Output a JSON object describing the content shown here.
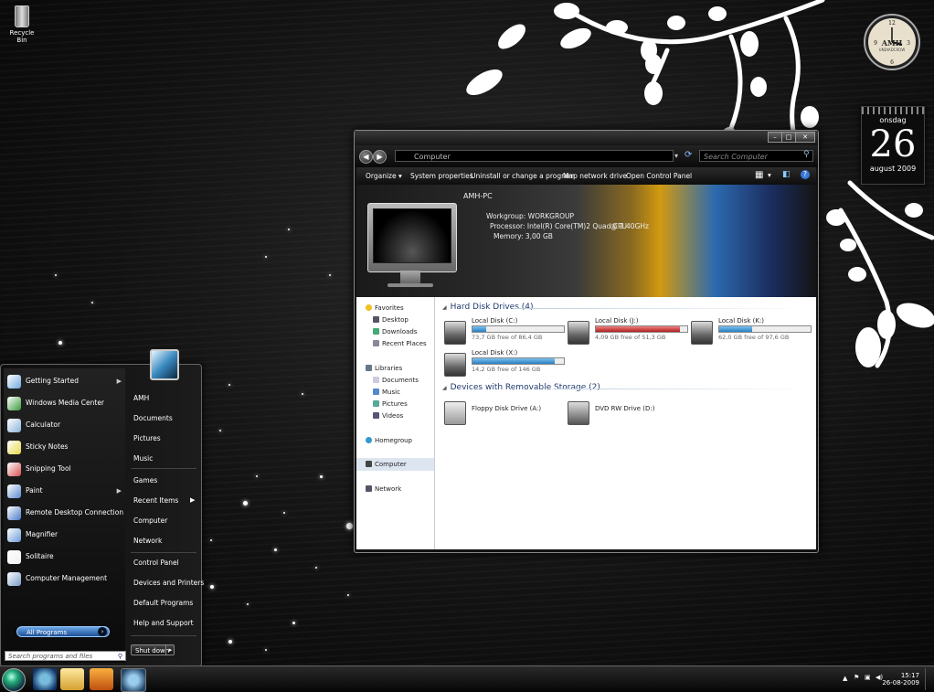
{
  "desktop": {
    "recycle_bin_label": "Recycle Bin"
  },
  "gadgets": {
    "clock_brand": "AMH",
    "clock_sub": "UNDIADCROW",
    "calendar_day_name": "onsdag",
    "calendar_day": "26",
    "calendar_month_year": "august 2009"
  },
  "explorer": {
    "address": "Computer",
    "search_placeholder": "Search Computer",
    "commands": [
      "Organize ▾",
      "System properties",
      "Uninstall or change a program",
      "Map network drive",
      "Open Control Panel"
    ],
    "pc_name": "AMH-PC",
    "workgroup": "Workgroup: WORKGROUP",
    "processor": "Processor: Intel(R) Core(TM)2 Quad CPU",
    "cpu_speed": "@ 2.40GHz",
    "memory": "Memory: 3,00 GB",
    "nav": {
      "favorites": "Favorites",
      "desktop": "Desktop",
      "downloads": "Downloads",
      "recent_places": "Recent Places",
      "libraries": "Libraries",
      "documents": "Documents",
      "music": "Music",
      "pictures": "Pictures",
      "videos": "Videos",
      "homegroup": "Homegroup",
      "computer": "Computer",
      "network": "Network"
    },
    "hard_disk_header": "Hard Disk Drives (4)",
    "removable_header": "Devices with Removable Storage (2)",
    "drives": [
      {
        "name": "Local Disk (C:)",
        "free": "73,7 GB free of 86,4 GB",
        "used_fraction": 0.15,
        "warn": false
      },
      {
        "name": "Local Disk (J:)",
        "free": "4,09 GB free of 51,3 GB",
        "used_fraction": 0.92,
        "warn": true
      },
      {
        "name": "Local Disk (K:)",
        "free": "62,0 GB free of 97,6 GB",
        "used_fraction": 0.36,
        "warn": false
      },
      {
        "name": "Local Disk (X:)",
        "free": "14,2 GB free of 146 GB",
        "used_fraction": 0.9,
        "warn": false
      }
    ],
    "removable": [
      {
        "name": "Floppy Disk Drive (A:)"
      },
      {
        "name": "DVD RW Drive (D:)"
      }
    ]
  },
  "start_menu": {
    "programs": [
      {
        "label": "Getting Started",
        "arrow": true,
        "icon_color": "#6fa8dc"
      },
      {
        "label": "Windows Media Center",
        "arrow": false,
        "icon_color": "#3a9a3a"
      },
      {
        "label": "Calculator",
        "arrow": false,
        "icon_color": "#8ab4d8"
      },
      {
        "label": "Sticky Notes",
        "arrow": false,
        "icon_color": "#e6d84a"
      },
      {
        "label": "Snipping Tool",
        "arrow": false,
        "icon_color": "#d85050"
      },
      {
        "label": "Paint",
        "arrow": true,
        "icon_color": "#5a8ad0"
      },
      {
        "label": "Remote Desktop Connection",
        "arrow": false,
        "icon_color": "#4a78c8"
      },
      {
        "label": "Magnifier",
        "arrow": false,
        "icon_color": "#6a9ad8"
      },
      {
        "label": "Solitaire",
        "arrow": false,
        "icon_color": "#f0f0f0"
      },
      {
        "label": "Computer Management",
        "arrow": false,
        "icon_color": "#7a9ac8"
      }
    ],
    "all_programs": "All Programs",
    "search_placeholder": "Search programs and files",
    "right_items": [
      "AMH",
      "Documents",
      "Pictures",
      "Music",
      "Games",
      "Recent Items",
      "Computer",
      "Network",
      "Control Panel",
      "Devices and Printers",
      "Default Programs",
      "Help and Support"
    ],
    "shutdown": "Shut down"
  },
  "taskbar": {
    "time": "15:17",
    "date": "26-08-2009"
  }
}
